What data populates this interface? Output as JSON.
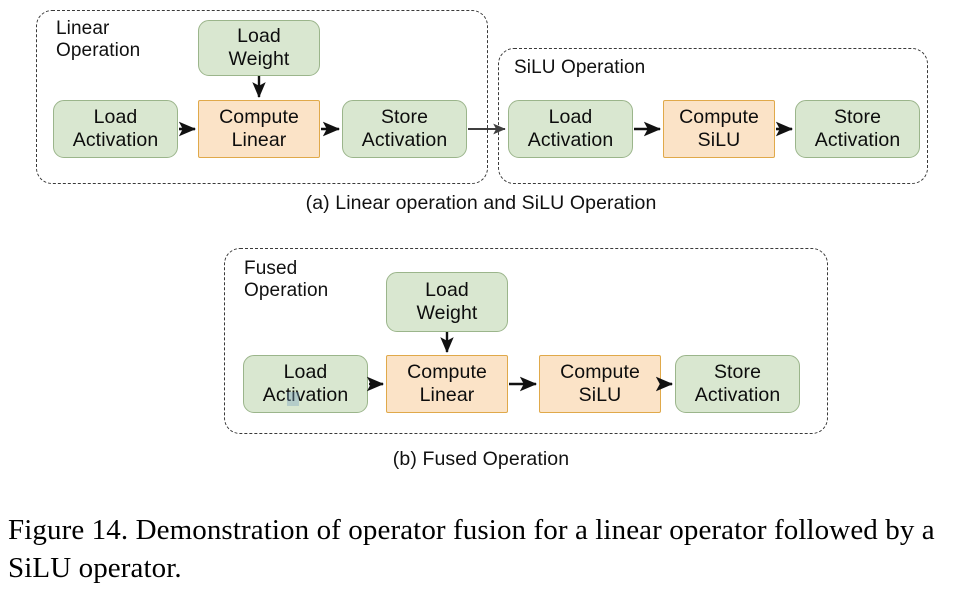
{
  "figure": {
    "caption": "Figure 14. Demonstration of operator fusion for a linear operator followed by a SiLU operator."
  },
  "panels": [
    {
      "id": "panel-a",
      "subcaption": "(a) Linear operation and SiLU Operation",
      "groups": [
        {
          "id": "linear-operation",
          "label": "Linear\nOperation",
          "nodes": [
            {
              "id": "load-weight",
              "label": "Load\nWeight",
              "kind": "green"
            },
            {
              "id": "load-activation",
              "label": "Load\nActivation",
              "kind": "green"
            },
            {
              "id": "compute-linear",
              "label": "Compute\nLinear",
              "kind": "orange"
            },
            {
              "id": "store-activation",
              "label": "Store\nActivation",
              "kind": "green"
            }
          ]
        },
        {
          "id": "silu-operation",
          "label": "SiLU Operation",
          "nodes": [
            {
              "id": "load-activation-2",
              "label": "Load\nActivation",
              "kind": "green"
            },
            {
              "id": "compute-silu",
              "label": "Compute\nSiLU",
              "kind": "orange"
            },
            {
              "id": "store-activation-2",
              "label": "Store\nActivation",
              "kind": "green"
            }
          ]
        }
      ]
    },
    {
      "id": "panel-b",
      "subcaption": "(b) Fused Operation",
      "groups": [
        {
          "id": "fused-operation",
          "label": "Fused\nOperation",
          "nodes": [
            {
              "id": "load-weight-b",
              "label": "Load\nWeight",
              "kind": "green"
            },
            {
              "id": "load-activation-b",
              "label": "Load\nActivation",
              "kind": "green"
            },
            {
              "id": "compute-linear-b",
              "label": "Compute\nLinear",
              "kind": "orange"
            },
            {
              "id": "compute-silu-b",
              "label": "Compute\nSiLU",
              "kind": "orange"
            },
            {
              "id": "store-activation-b",
              "label": "Store\nActivation",
              "kind": "green"
            }
          ]
        }
      ]
    }
  ],
  "colors": {
    "green_fill": "#d9e7d0",
    "green_stroke": "#9bb58b",
    "orange_fill": "#fbe3c7",
    "orange_stroke": "#e0a94a",
    "group_stroke": "#3a3a3a",
    "arrow": "#111111",
    "text": "#0d0d0d",
    "background": "#ffffff"
  }
}
